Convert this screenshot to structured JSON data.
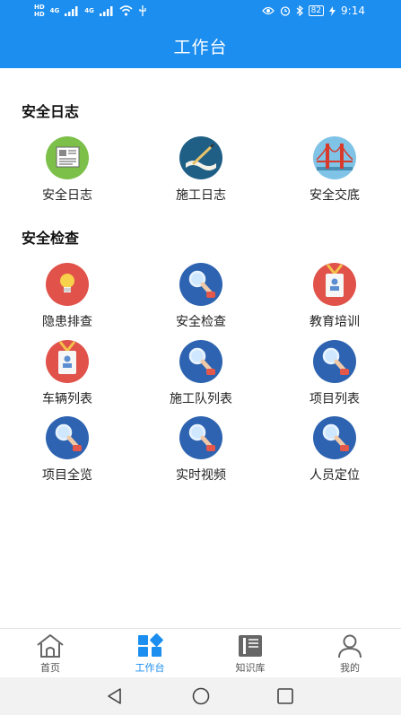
{
  "status_bar": {
    "left_tags": [
      "HD",
      "HD"
    ],
    "signal_labels": [
      "4G",
      "4G"
    ],
    "battery": "82",
    "time": "9:14"
  },
  "header": {
    "title": "工作台"
  },
  "sections": [
    {
      "title": "安全日志",
      "items": [
        {
          "label": "安全日志",
          "icon": "document-icon"
        },
        {
          "label": "施工日志",
          "icon": "writing-icon"
        },
        {
          "label": "安全交底",
          "icon": "bridge-icon"
        }
      ]
    },
    {
      "title": "安全检查",
      "items": [
        {
          "label": "隐患排查",
          "icon": "lightbulb-icon"
        },
        {
          "label": "安全检查",
          "icon": "magnifier-icon"
        },
        {
          "label": "教育培训",
          "icon": "badge-icon"
        },
        {
          "label": "车辆列表",
          "icon": "badge-icon"
        },
        {
          "label": "施工队列表",
          "icon": "magnifier-icon"
        },
        {
          "label": "项目列表",
          "icon": "magnifier-icon"
        },
        {
          "label": "项目全览",
          "icon": "magnifier-icon"
        },
        {
          "label": "实时视频",
          "icon": "magnifier-icon"
        },
        {
          "label": "人员定位",
          "icon": "magnifier-icon"
        }
      ]
    }
  ],
  "tabs": [
    {
      "label": "首页",
      "icon": "home-icon",
      "active": false
    },
    {
      "label": "工作台",
      "icon": "dashboard-icon",
      "active": true
    },
    {
      "label": "知识库",
      "icon": "book-icon",
      "active": false
    },
    {
      "label": "我的",
      "icon": "user-icon",
      "active": false
    }
  ],
  "colors": {
    "primary": "#1c8ef0",
    "icon_blue": "#2d63b0",
    "icon_red": "#e0524a",
    "icon_green": "#7cc04a",
    "icon_navy": "#1f5f86",
    "icon_lightblue": "#7fc3e6"
  }
}
